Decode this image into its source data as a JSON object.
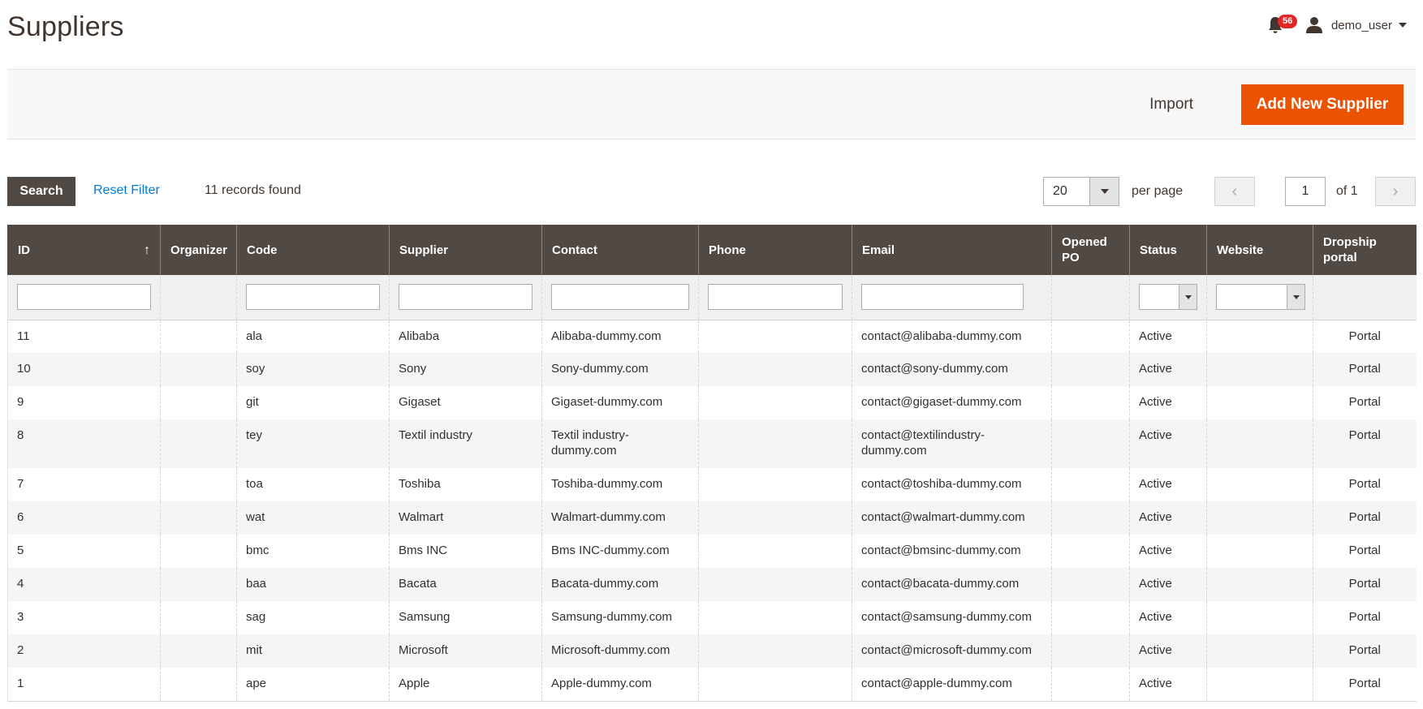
{
  "page": {
    "title": "Suppliers"
  },
  "header": {
    "notification_count": "56",
    "notification_icon": "bell-icon",
    "user_icon": "user-icon",
    "user_name": "demo_user"
  },
  "actions": {
    "import_label": "Import",
    "add_label": "Add New Supplier",
    "accent_color": "#eb5202"
  },
  "toolbar": {
    "search_label": "Search",
    "reset_label": "Reset Filter",
    "records_text": "11 records found",
    "per_page_value": "20",
    "per_page_label": "per page",
    "page_value": "1",
    "page_total": "of 1"
  },
  "columns": [
    {
      "label": "ID",
      "sorted": "asc"
    },
    {
      "label": "Organizer"
    },
    {
      "label": "Code"
    },
    {
      "label": "Supplier"
    },
    {
      "label": "Contact"
    },
    {
      "label": "Phone"
    },
    {
      "label": "Email"
    },
    {
      "label": "Opened PO"
    },
    {
      "label": "Status"
    },
    {
      "label": "Website"
    },
    {
      "label": "Dropship portal"
    }
  ],
  "rows": [
    {
      "id": "11",
      "organizer": "",
      "code": "ala",
      "supplier": "Alibaba",
      "contact": "Alibaba-dummy.com",
      "phone": "",
      "email": "contact@alibaba-dummy.com",
      "opened_po": "",
      "status": "Active",
      "website": "",
      "portal": "Portal"
    },
    {
      "id": "10",
      "organizer": "",
      "code": "soy",
      "supplier": "Sony",
      "contact": "Sony-dummy.com",
      "phone": "",
      "email": "contact@sony-dummy.com",
      "opened_po": "",
      "status": "Active",
      "website": "",
      "portal": "Portal"
    },
    {
      "id": "9",
      "organizer": "",
      "code": "git",
      "supplier": "Gigaset",
      "contact": "Gigaset-dummy.com",
      "phone": "",
      "email": "contact@gigaset-dummy.com",
      "opened_po": "",
      "status": "Active",
      "website": "",
      "portal": "Portal"
    },
    {
      "id": "8",
      "organizer": "",
      "code": "tey",
      "supplier": "Textil industry",
      "contact": "Textil industry-dummy.com",
      "phone": "",
      "email": "contact@textilindustry-dummy.com",
      "opened_po": "",
      "status": "Active",
      "website": "",
      "portal": "Portal"
    },
    {
      "id": "7",
      "organizer": "",
      "code": "toa",
      "supplier": "Toshiba",
      "contact": "Toshiba-dummy.com",
      "phone": "",
      "email": "contact@toshiba-dummy.com",
      "opened_po": "",
      "status": "Active",
      "website": "",
      "portal": "Portal"
    },
    {
      "id": "6",
      "organizer": "",
      "code": "wat",
      "supplier": "Walmart",
      "contact": "Walmart-dummy.com",
      "phone": "",
      "email": "contact@walmart-dummy.com",
      "opened_po": "",
      "status": "Active",
      "website": "",
      "portal": "Portal"
    },
    {
      "id": "5",
      "organizer": "",
      "code": "bmc",
      "supplier": "Bms INC",
      "contact": "Bms INC-dummy.com",
      "phone": "",
      "email": "contact@bmsinc-dummy.com",
      "opened_po": "",
      "status": "Active",
      "website": "",
      "portal": "Portal"
    },
    {
      "id": "4",
      "organizer": "",
      "code": "baa",
      "supplier": "Bacata",
      "contact": "Bacata-dummy.com",
      "phone": "",
      "email": "contact@bacata-dummy.com",
      "opened_po": "",
      "status": "Active",
      "website": "",
      "portal": "Portal"
    },
    {
      "id": "3",
      "organizer": "",
      "code": "sag",
      "supplier": "Samsung",
      "contact": "Samsung-dummy.com",
      "phone": "",
      "email": "contact@samsung-dummy.com",
      "opened_po": "",
      "status": "Active",
      "website": "",
      "portal": "Portal"
    },
    {
      "id": "2",
      "organizer": "",
      "code": "mit",
      "supplier": "Microsoft",
      "contact": "Microsoft-dummy.com",
      "phone": "",
      "email": "contact@microsoft-dummy.com",
      "opened_po": "",
      "status": "Active",
      "website": "",
      "portal": "Portal"
    },
    {
      "id": "1",
      "organizer": "",
      "code": "ape",
      "supplier": "Apple",
      "contact": "Apple-dummy.com",
      "phone": "",
      "email": "contact@apple-dummy.com",
      "opened_po": "",
      "status": "Active",
      "website": "",
      "portal": "Portal"
    }
  ]
}
